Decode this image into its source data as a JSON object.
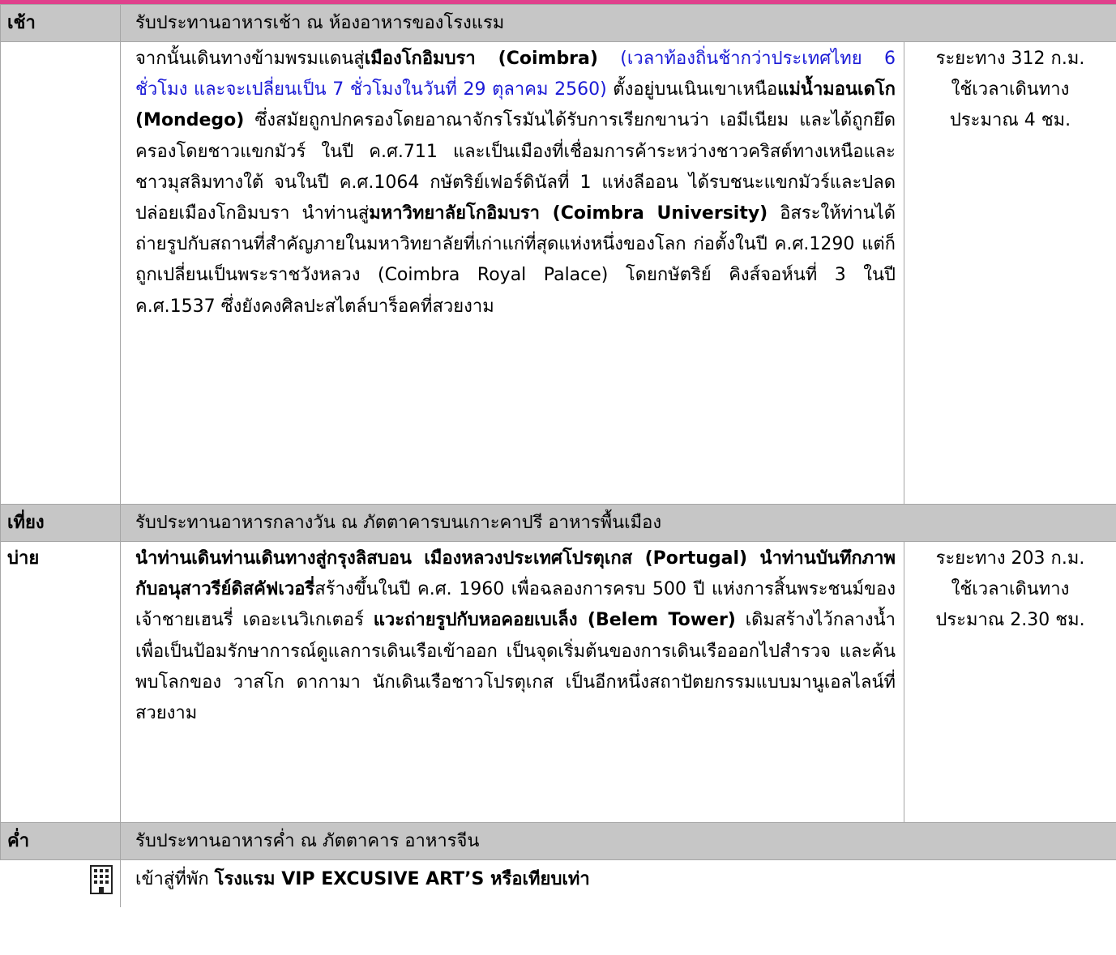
{
  "rows": {
    "breakfast": {
      "time": "เช้า",
      "desc": "รับประทานอาหารเช้า ณ ห้องอาหารของโรงแรม"
    },
    "coimbra": {
      "p1": "จากนั้นเดินทางข้ามพรมแดนสู่",
      "p2": "เมืองโกอิมบรา (Coimbra)",
      "p3": " (เวลาท้องถิ่นช้ากว่าประเทศไทย 6 ชั่วโมง และจะเปลี่ยนเป็น 7 ชั่วโมงในวันที่ 29 ตุลาคม 2560)",
      "p4": " ตั้งอยู่บนเนินเขาเหนือ",
      "p5": "แม่น้ำมอนเดโก (Mondego)",
      "p6": " ซึ่งสมัยถูกปกครองโดยอาณาจักรโรมันได้รับการเรียกขานว่า เอมีเนียม และได้ถูกยึดครองโดยชาวแขกมัวร์ ในปี ค.ศ.711 และเป็นเมืองที่เชื่อมการค้าระหว่างชาวคริสต์ทางเหนือและชาวมุสลิมทางใต้ จนในปี ค.ศ.1064 กษัตริย์เฟอร์ดินัลที่ 1 แห่งลีออน ได้รบชนะแขกมัวร์และปลดปล่อยเมืองโกอิมบรา นำท่านสู่",
      "p7": "มหาวิทยาลัยโกอิมบรา (Coimbra University)",
      "p8": " อิสระให้ท่านได้ถ่ายรูปกับสถานที่สำคัญภายในมหาวิทยาลัยที่เก่าแก่ที่สุดแห่งหนึ่งของโลก ก่อตั้งในปี ค.ศ.1290 แต่ก็ถูกเปลี่ยนเป็นพระราชวังหลวง (Coimbra Royal Palace) โดยกษัตริย์ คิงส์จอห์นที่ 3 ในปี ค.ศ.1537 ซึ่งยังคงศิลปะสไตล์บาร็อคที่สวยงาม",
      "dist1": "ระยะทาง 312 ก.ม.",
      "dist2": "ใช้เวลาเดินทาง",
      "dist3": "ประมาณ 4 ชม."
    },
    "lunch": {
      "time": "เที่ยง",
      "desc": "รับประทานอาหารกลางวัน ณ ภัตตาคารบนเกาะคาปรี อาหารพื้นเมือง"
    },
    "afternoon": {
      "time": "บ่าย",
      "p1": "นำท่านเดินท่านเดินทางสู่กรุงลิสบอน เมืองหลวงประเทศโปรตุเกส (Portugal) นำท่านบันทึกภาพกับอนุสาวรีย์ดิสคัฟเวอรี่",
      "p2": "สร้างขึ้นในปี ค.ศ. 1960 เพื่อฉลองการครบ 500 ปี แห่งการสิ้นพระชนม์ของเจ้าชายเฮนรี่ เดอะเนวิเกเตอร์ ",
      "p3": "แวะถ่ายรูปกับหอคอยเบเล็ง (Belem Tower)",
      "p4": " เดิมสร้างไว้กลางน้ำเพื่อเป็นป้อมรักษาการณ์ดูแลการเดินเรือเข้าออก เป็นจุดเริ่มต้นของการเดินเรือออกไปสำรวจ และค้นพบโลกของ วาสโก ดากามา นักเดินเรือชาวโปรตุเกส เป็นอีกหนึ่งสถาปัตยกรรมแบบมานูเอลไลน์ที่สวยงาม",
      "dist1": "ระยะทาง 203 ก.ม.",
      "dist2": "ใช้เวลาเดินทาง",
      "dist3": "ประมาณ 2.30 ชม."
    },
    "dinner": {
      "time": "ค่ำ",
      "desc": "รับประทานอาหารค่ำ ณ ภัตตาคาร อาหารจีน"
    },
    "hotel": {
      "icon": "hotel-building-icon",
      "p1": "เข้าสู่ที่พัก ",
      "p2": "โรงแรม VIP EXCUSIVE ART’S หรือเทียบเท่า"
    }
  },
  "colors": {
    "accent_bar": "#e0408c",
    "meal_row_bg": "#c6c6c6",
    "link_blue": "#1a1ad6",
    "border": "#a6a6a6"
  }
}
